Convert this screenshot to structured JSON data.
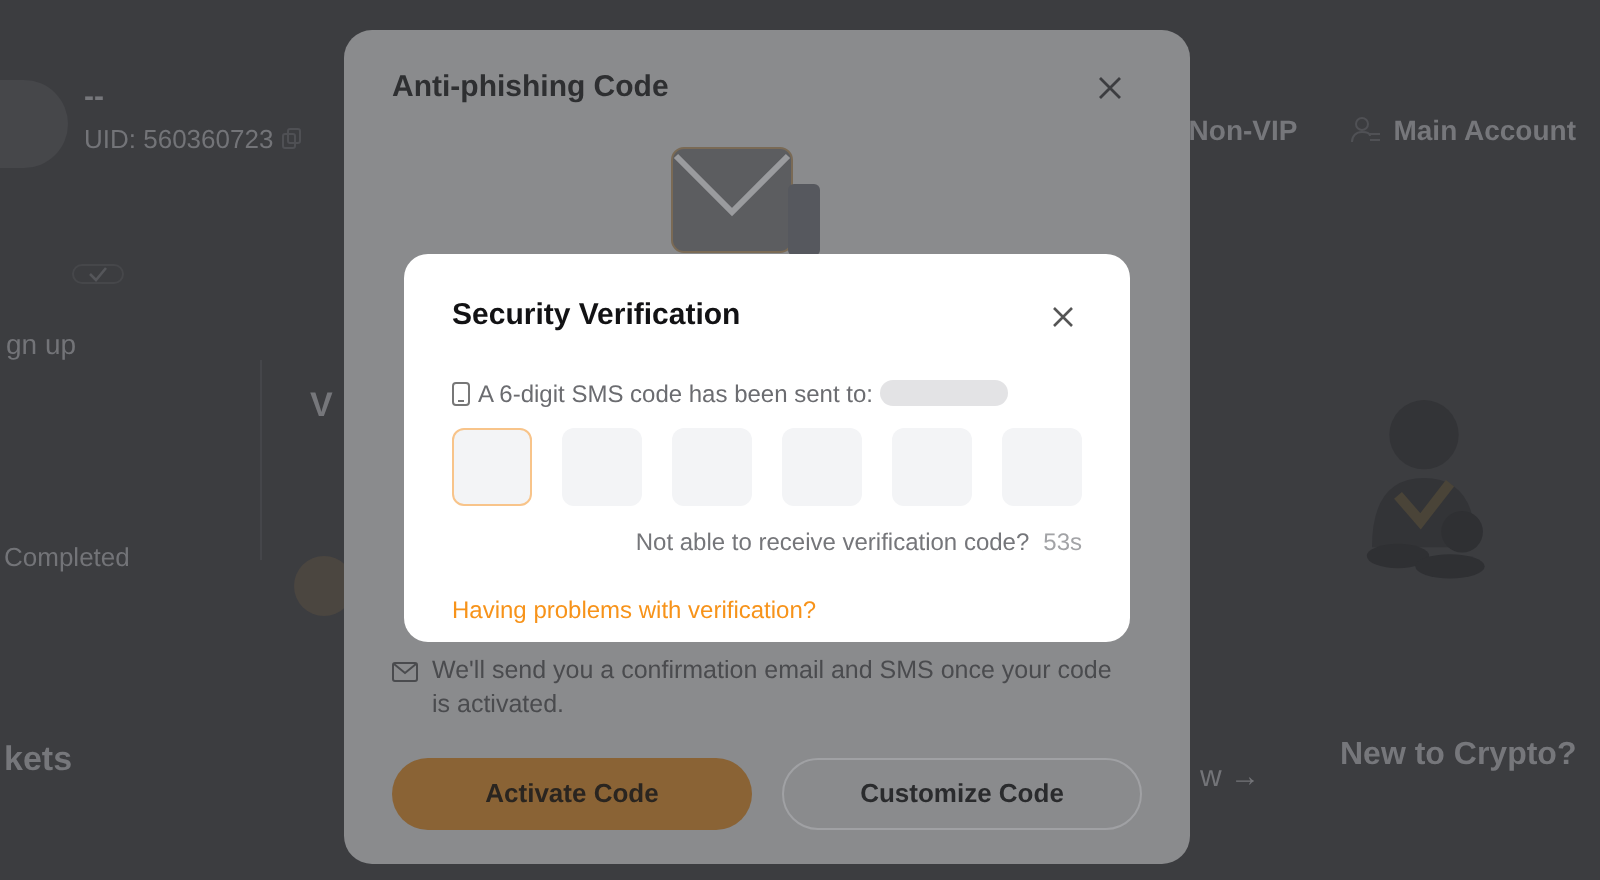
{
  "background": {
    "profile": {
      "name": "--",
      "uid": "UID: 560360723"
    },
    "header_items": [
      {
        "kind": "vip",
        "label": "Non-VIP"
      },
      {
        "kind": "account",
        "label": "Main Account"
      }
    ],
    "steps": [
      {
        "label": "gn up",
        "done": true
      },
      {
        "label": "Completed"
      }
    ],
    "heading_fragment": "V",
    "markets_fragment": "kets",
    "view_link": "w →",
    "new_to_crypto": "New to Crypto?"
  },
  "anti_phishing": {
    "title": "Anti-phishing Code",
    "note": "We'll send you a confirmation email and SMS once your code is activated.",
    "buttons": [
      {
        "kind": "primary",
        "label": "Activate Code"
      },
      {
        "kind": "outline",
        "label": "Customize Code"
      }
    ]
  },
  "verification": {
    "title": "Security Verification",
    "sent_text": "A 6-digit SMS code has been sent to:",
    "code_boxes": [
      {
        "focused": true
      },
      {
        "focused": false
      },
      {
        "focused": false
      },
      {
        "focused": false
      },
      {
        "focused": false
      },
      {
        "focused": false
      }
    ],
    "resend_text": "Not able to receive verification code?",
    "countdown": "53s",
    "help_link": "Having problems with verification?"
  }
}
